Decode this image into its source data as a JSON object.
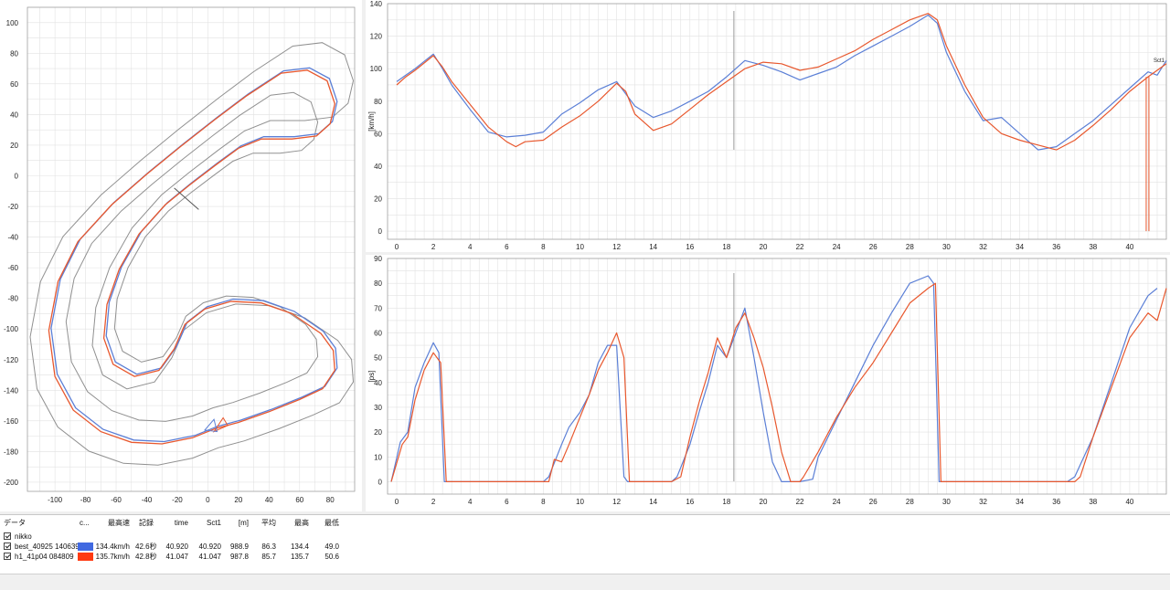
{
  "colors": {
    "blue": "#5b7fd6",
    "red": "#e8582e",
    "track": "#909090",
    "grid": "#e2e2e2",
    "cursor": "#9a9a9a"
  },
  "map": {
    "x_ticks": [
      "-100",
      "-80",
      "-60",
      "-40",
      "-20",
      "0",
      "20",
      "40",
      "60",
      "80"
    ],
    "y_ticks": [
      "100",
      "80",
      "60",
      "40",
      "20",
      "0",
      "-20",
      "-40",
      "-60",
      "-80",
      "-100",
      "-120",
      "-140",
      "-160",
      "-180",
      "-200"
    ]
  },
  "speed_chart": {
    "ylabel": "[km/h]",
    "y_ticks": [
      "140",
      "120",
      "100",
      "80",
      "60",
      "40",
      "20",
      "0"
    ],
    "x_ticks": [
      "0",
      "2",
      "4",
      "6",
      "8",
      "10",
      "12",
      "14",
      "16",
      "18",
      "20",
      "22",
      "24",
      "26",
      "28",
      "30",
      "32",
      "34",
      "36",
      "38",
      "40"
    ],
    "marker_label": "Sct1"
  },
  "ps_chart": {
    "ylabel": "[ps]",
    "y_ticks": [
      "90",
      "80",
      "70",
      "60",
      "50",
      "40",
      "30",
      "20",
      "10",
      "0"
    ],
    "x_ticks": [
      "0",
      "2",
      "4",
      "6",
      "8",
      "10",
      "12",
      "14",
      "16",
      "18",
      "20",
      "22",
      "24",
      "26",
      "28",
      "30",
      "32",
      "34",
      "36",
      "38",
      "40"
    ]
  },
  "chart_data": [
    {
      "type": "line",
      "title": "",
      "xlabel": "",
      "ylabel": "[km/h]",
      "xlim": [
        -0.5,
        42
      ],
      "ylim": [
        -5,
        140
      ],
      "grid": true,
      "series": [
        {
          "name": "best_40925 140639",
          "color": "#5b7fd6",
          "x": [
            0,
            0.5,
            1,
            2,
            2.5,
            3,
            4,
            5,
            6,
            7,
            8,
            9,
            10,
            11,
            12,
            13,
            14,
            15,
            16,
            17,
            18,
            18.5,
            19,
            20,
            21,
            22,
            23,
            24,
            25,
            26,
            27,
            28,
            29,
            29.5,
            30,
            31,
            32,
            33,
            34,
            35,
            36,
            37,
            38,
            39,
            40,
            41,
            41.5,
            42
          ],
          "y": [
            92,
            96,
            100,
            109,
            100,
            90,
            75,
            61,
            58,
            59,
            61,
            72,
            79,
            87,
            92,
            77,
            70,
            74,
            80,
            86,
            95,
            100,
            105,
            102,
            98,
            93,
            97,
            101,
            108,
            114,
            120,
            126,
            133,
            128,
            110,
            86,
            68,
            70,
            60,
            50,
            52,
            60,
            68,
            78,
            88,
            98,
            96,
            105
          ]
        },
        {
          "name": "h1_41p04 084809",
          "color": "#e8582e",
          "x": [
            0,
            0.5,
            1,
            2,
            2.5,
            3,
            4,
            5,
            6,
            6.5,
            7,
            8,
            9,
            10,
            11,
            12,
            12.5,
            13,
            14,
            15,
            16,
            17,
            18,
            18.5,
            19,
            20,
            21,
            22,
            23,
            24,
            25,
            26,
            27,
            28,
            29,
            29.5,
            30,
            31,
            32,
            33,
            34,
            35,
            36,
            37,
            38,
            39,
            40,
            41,
            42
          ],
          "y": [
            90,
            95,
            99,
            108,
            101,
            92,
            78,
            64,
            55,
            52,
            55,
            56,
            64,
            71,
            80,
            91,
            86,
            72,
            62,
            66,
            75,
            84,
            92,
            96,
            100,
            104,
            103,
            99,
            101,
            106,
            111,
            118,
            124,
            130,
            134,
            130,
            114,
            90,
            70,
            60,
            56,
            53,
            50,
            56,
            65,
            75,
            86,
            95,
            103
          ]
        }
      ]
    },
    {
      "type": "line",
      "title": "",
      "xlabel": "",
      "ylabel": "[ps]",
      "xlim": [
        -0.5,
        42
      ],
      "ylim": [
        -5,
        90
      ],
      "grid": true,
      "series": [
        {
          "name": "best_40925 140639",
          "color": "#5b7fd6",
          "x": [
            -0.3,
            0.2,
            0.6,
            1,
            1.5,
            2,
            2.3,
            2.6,
            3,
            5,
            8,
            8.3,
            9,
            9.4,
            10,
            10.5,
            11,
            11.5,
            12,
            12.4,
            12.6,
            13,
            15,
            15.3,
            16,
            16.5,
            17,
            17.5,
            18,
            18.5,
            19,
            19.5,
            20,
            20.5,
            21,
            21.5,
            22,
            22.7,
            23,
            24,
            25,
            26,
            27,
            28,
            29,
            29.3,
            29.6,
            30,
            32,
            36.6,
            37,
            38,
            39,
            40,
            41,
            41.5
          ],
          "y": [
            0,
            16,
            20,
            38,
            48,
            56,
            52,
            0,
            0,
            0,
            0,
            2,
            15,
            22,
            28,
            35,
            48,
            55,
            55,
            2,
            0,
            0,
            0,
            2,
            15,
            28,
            40,
            55,
            50,
            60,
            70,
            50,
            28,
            8,
            0,
            0,
            0,
            1,
            10,
            25,
            40,
            55,
            68,
            80,
            83,
            80,
            0,
            0,
            0,
            0,
            2,
            18,
            40,
            62,
            75,
            78
          ]
        },
        {
          "name": "h1_41p04 084809",
          "color": "#e8582e",
          "x": [
            -0.3,
            0.3,
            0.6,
            1,
            1.5,
            2,
            2.4,
            2.7,
            3,
            5,
            8.3,
            8.6,
            9,
            9.4,
            10,
            10.5,
            11,
            11.5,
            12,
            12.4,
            12.7,
            13,
            15,
            15.5,
            16,
            16.5,
            17,
            17.5,
            18,
            18.5,
            19,
            19.5,
            20,
            20.5,
            21,
            21.5,
            22,
            22.2,
            23,
            24,
            25,
            26,
            27,
            28,
            29,
            29.4,
            29.7,
            30,
            32,
            37,
            37.3,
            38,
            39,
            40,
            41,
            41.5,
            42
          ],
          "y": [
            0,
            15,
            18,
            33,
            45,
            52,
            48,
            0,
            0,
            0,
            0,
            9,
            8,
            15,
            26,
            35,
            45,
            52,
            60,
            50,
            0,
            0,
            0,
            2,
            18,
            32,
            44,
            58,
            50,
            62,
            68,
            58,
            46,
            30,
            12,
            0,
            0,
            2,
            12,
            26,
            38,
            48,
            60,
            72,
            78,
            80,
            0,
            0,
            0,
            0,
            2,
            18,
            38,
            58,
            68,
            65,
            78
          ]
        }
      ]
    }
  ],
  "legend": {
    "headers": {
      "data": "データ",
      "color": "c...",
      "max_speed": "最高速",
      "record": "記録",
      "time": "time",
      "sct1": "Sct1",
      "dist": "[m]",
      "avg": "平均",
      "max": "最高",
      "min": "最低"
    },
    "group": {
      "name": "nikko"
    },
    "rows": [
      {
        "name": "best_40925 140639",
        "color": "#4169e1",
        "max_speed": "134.4km/h",
        "record": "42.6秒",
        "time": "40.920",
        "sct1": "40.920",
        "dist": "988.9",
        "avg": "86.3",
        "max": "134.4",
        "min": "49.0"
      },
      {
        "name": "h1_41p04 084809",
        "color": "#ff3a12",
        "max_speed": "135.7km/h",
        "record": "42.8秒",
        "time": "41.047",
        "sct1": "41.047",
        "dist": "987.8",
        "avg": "85.7",
        "max": "135.7",
        "min": "50.6"
      }
    ]
  }
}
